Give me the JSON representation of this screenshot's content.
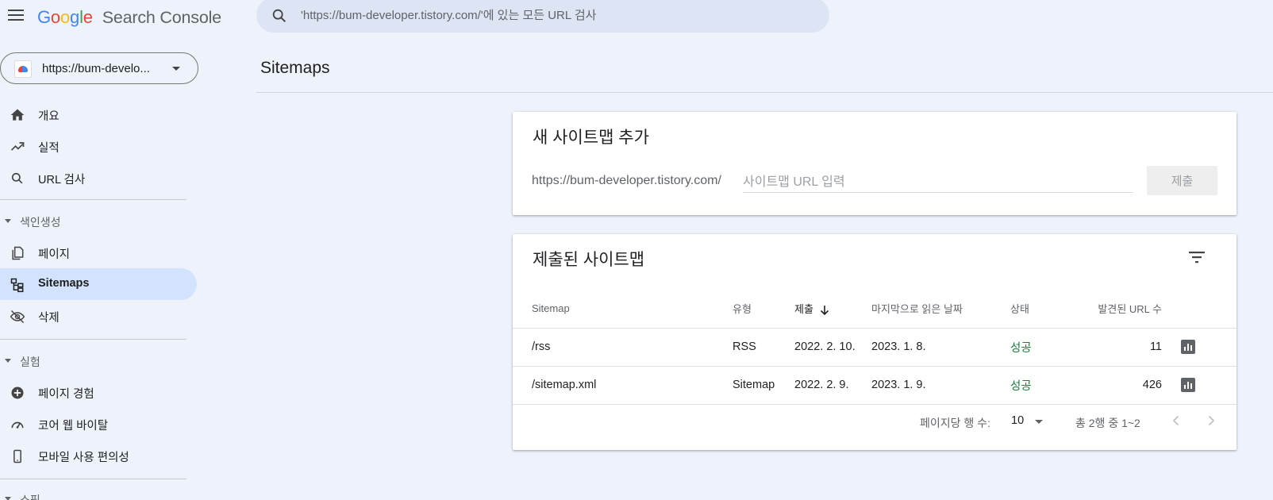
{
  "header": {
    "logo_google": [
      "G",
      "o",
      "o",
      "g",
      "l",
      "e"
    ],
    "logo_colors": [
      "#4285f4",
      "#ea4335",
      "#fbbc05",
      "#4285f4",
      "#34a853",
      "#ea4335"
    ],
    "logo_product": "Search Console",
    "search_placeholder": "'https://bum-developer.tistory.com/'에 있는 모든 URL 검사"
  },
  "sidebar": {
    "property_label": "https://bum-develo...",
    "items": [
      {
        "label": "개요",
        "icon": "home-icon"
      },
      {
        "label": "실적",
        "icon": "trending-up-icon"
      },
      {
        "label": "URL 검사",
        "icon": "search-icon"
      },
      {
        "label": "페이지",
        "icon": "pages-icon"
      },
      {
        "label": "Sitemaps",
        "icon": "sitemap-icon",
        "active": true
      },
      {
        "label": "삭제",
        "icon": "visibility-off-icon"
      },
      {
        "label": "페이지 경험",
        "icon": "add-circle-icon"
      },
      {
        "label": "코어 웹 바이탈",
        "icon": "speed-icon"
      },
      {
        "label": "모바일 사용 편의성",
        "icon": "smartphone-icon"
      }
    ],
    "sections": [
      "색인생성",
      "실험",
      "쇼핑"
    ]
  },
  "main": {
    "title": "Sitemaps",
    "add_card": {
      "title": "새 사이트맵 추가",
      "url_prefix": "https://bum-developer.tistory.com/",
      "input_placeholder": "사이트맵 URL 입력",
      "submit_label": "제출"
    },
    "submitted_card": {
      "title": "제출된 사이트맵",
      "columns": [
        "Sitemap",
        "유형",
        "제출",
        "마지막으로 읽은 날짜",
        "상태",
        "발견된 URL 수"
      ],
      "rows": [
        {
          "sitemap": "/rss",
          "type": "RSS",
          "submitted": "2022. 2. 10.",
          "last_read": "2023. 1. 8.",
          "status": "성공",
          "urls": "11"
        },
        {
          "sitemap": "/sitemap.xml",
          "type": "Sitemap",
          "submitted": "2022. 2. 9.",
          "last_read": "2023. 1. 9.",
          "status": "성공",
          "urls": "426"
        }
      ],
      "pagination": {
        "rows_per_page_label": "페이지당 행 수:",
        "rows_per_page": "10",
        "range": "총 2행 중 1~2"
      }
    }
  },
  "colors": {
    "accent_active": "#d3e3fd",
    "status_success": "#188038",
    "background": "#eef2fa"
  }
}
